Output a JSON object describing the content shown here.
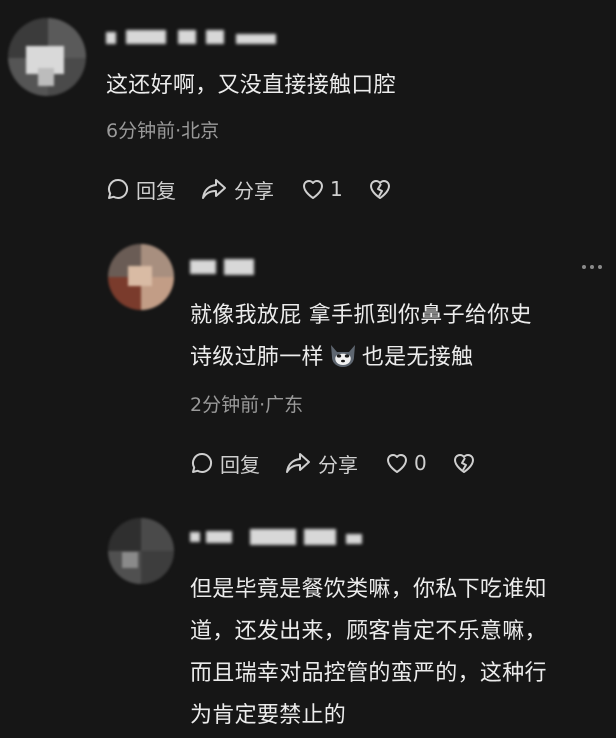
{
  "comments": [
    {
      "text_lines": [
        "这还好啊，又没直接接触口腔"
      ],
      "meta": "6分钟前·北京",
      "reply_label": "回复",
      "share_label": "分享",
      "like_count": "1"
    },
    {
      "text_line1": "就像我放屁 拿手抓到你鼻子给你史",
      "text_line2_a": "诗级过肺一样",
      "text_line2_b": "也是无接触",
      "meta": "2分钟前·广东",
      "reply_label": "回复",
      "share_label": "分享",
      "like_count": "0"
    },
    {
      "text_lines": [
        "但是毕竟是餐饮类嘛，你私下吃谁知",
        "道，还发出来，顾客肯定不乐意嘛，",
        "而且瑞幸对品控管的蛮严的，这种行",
        "为肯定要禁止的"
      ]
    }
  ],
  "icons": {
    "reply": "comment-bubble-icon",
    "share": "share-arrow-icon",
    "like": "heart-icon",
    "dislike": "broken-heart-icon",
    "emoji": "husky-dog-emoji",
    "more": "more-dots-icon"
  },
  "colors": {
    "background": "#161616",
    "text": "#ececec",
    "meta": "#9a9a9a"
  }
}
